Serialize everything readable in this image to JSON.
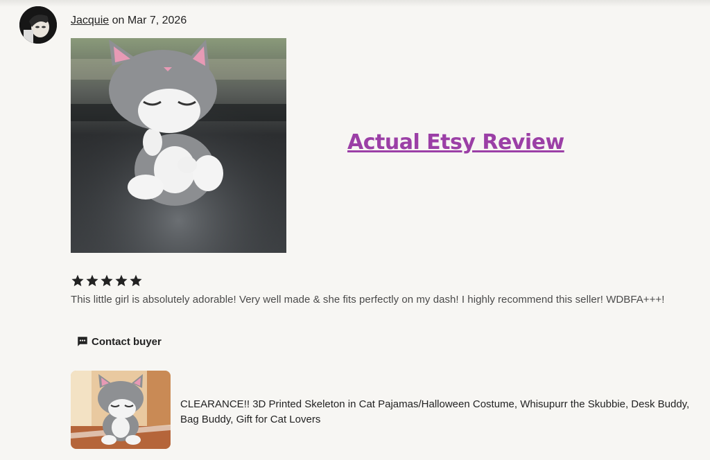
{
  "review": {
    "author": "Jacquie",
    "date_text": " on Mar 7, 2026",
    "rating": 5,
    "text": "This little girl is absolutely adorable! Very well made & she fits perfectly on my dash! I highly recommend this seller! WDBFA+++!"
  },
  "overlay": {
    "title": "Actual Etsy Review",
    "color": "#9b3fa6"
  },
  "actions": {
    "contact_label": "Contact buyer",
    "contact_icon": "chat-bubble-icon"
  },
  "listing": {
    "title": "CLEARANCE!! 3D Printed Skeleton in Cat Pajamas/Halloween Costume, Whisupurr the Skubbie, Desk Buddy, Bag Buddy, Gift for Cat Lovers"
  }
}
